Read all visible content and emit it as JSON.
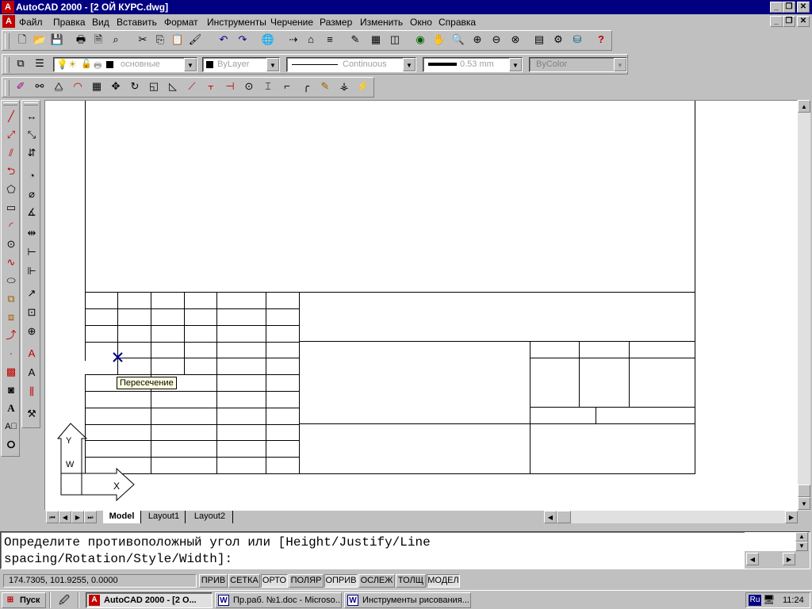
{
  "window": {
    "title": "AutoCAD 2000 - [2 ОЙ КУРС.dwg]"
  },
  "menu": [
    "Файл",
    "Правка",
    "Вид",
    "Вставить",
    "Формат",
    "Инструменты",
    "Черчение",
    "Размер",
    "Изменить",
    "Окно",
    "Справка"
  ],
  "properties": {
    "layer": "основные",
    "color": "ByLayer",
    "linetype": "Continuous",
    "lineweight": "0.53 mm",
    "plotstyle": "ByColor"
  },
  "tooltip": "Пересечение",
  "ucs": {
    "y": "Y",
    "w": "W",
    "x": "X"
  },
  "layout_tabs": [
    "Model",
    "Layout1",
    "Layout2"
  ],
  "command_lines": [
    "Определите противоположный угол или [Height/Justify/Line",
    "spacing/Rotation/Style/Width]:"
  ],
  "status": {
    "coords": "174.7305, 101.9255, 0.0000",
    "buttons": [
      "ПРИВ",
      "СЕТКА",
      "ОРТО",
      "ПОЛЯР",
      "ОПРИВ",
      "ОСЛЕЖ",
      "ТОЛЩ",
      "МОДЕЛ"
    ]
  },
  "taskbar": {
    "start": "Пуск",
    "tasks": [
      "AutoCAD 2000 - [2 О...",
      "Пр.раб. №1.doc - Microso...",
      "Инструменты рисования..."
    ],
    "lang": "Ru",
    "clock": "11:24"
  },
  "colors": {
    "title_bg": "#000080",
    "face": "#c0c0c0",
    "canvas": "#ffffff",
    "snap_marker": "#000080"
  }
}
